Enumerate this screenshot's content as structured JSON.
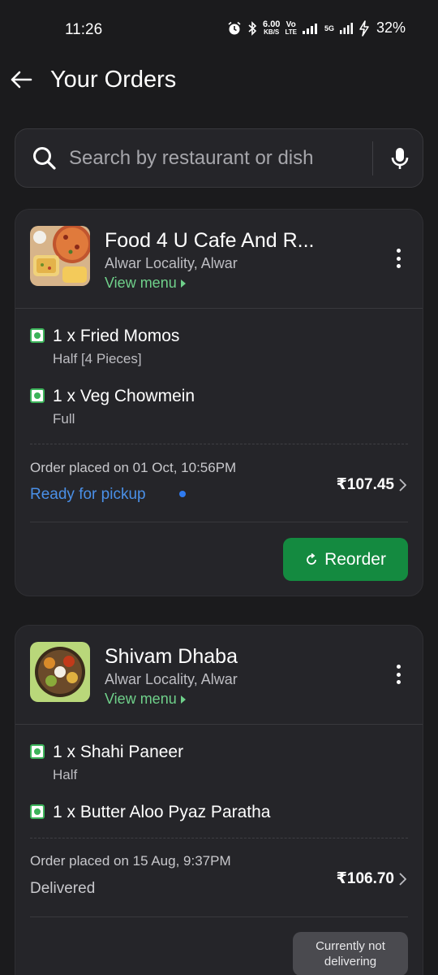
{
  "status_bar": {
    "time": "11:26",
    "net_speed_value": "6.00",
    "net_speed_unit": "KB/S",
    "volte_top": "Vo",
    "volte_bottom": "LTE",
    "network": "5G",
    "battery": "32%"
  },
  "header": {
    "title": "Your Orders",
    "back_icon": "arrow-left-icon"
  },
  "search": {
    "placeholder": "Search by restaurant or dish",
    "icon": "search-icon",
    "mic_icon": "mic-icon"
  },
  "orders": [
    {
      "restaurant": "Food 4 U Cafe And R...",
      "locality": "Alwar Locality, Alwar",
      "view_menu": "View menu",
      "items": [
        {
          "name": "1 x Fried Momos",
          "variant": "Half [4 Pieces]"
        },
        {
          "name": "1 x Veg Chowmein",
          "variant": "Full"
        }
      ],
      "placed_on": "Order placed on 01 Oct, 10:56PM",
      "status": "Ready for pickup",
      "status_color": "#4a90e8",
      "price": "₹107.45",
      "action": "Reorder"
    },
    {
      "restaurant": "Shivam Dhaba",
      "locality": "Alwar Locality, Alwar",
      "view_menu": "View menu",
      "items": [
        {
          "name": "1 x Shahi Paneer",
          "variant": "Half"
        },
        {
          "name": "1 x Butter Aloo Pyaz Paratha",
          "variant": ""
        }
      ],
      "placed_on": "Order placed on 15 Aug, 9:37PM",
      "status": "Delivered",
      "status_color": "#c8c8cc",
      "price": "₹106.70",
      "action_line1": "Currently not",
      "action_line2": "delivering"
    }
  ],
  "colors": {
    "background": "#1b1b1d",
    "card": "#252529",
    "accent_green": "#148a40",
    "link_green": "#6fd08a",
    "veg_green": "#3cb35a"
  }
}
